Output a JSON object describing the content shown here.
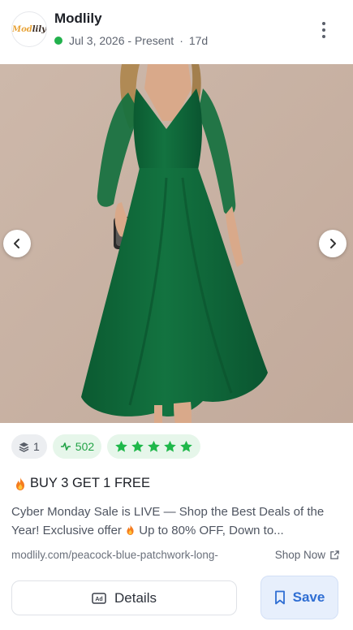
{
  "header": {
    "brand_name": "Modlily",
    "logo_text_a": "Mod",
    "logo_text_b": "lily",
    "date_range": "Jul 3, 2026 - Present",
    "separator": "·",
    "age": "17d",
    "status_color": "#22b14c"
  },
  "media": {
    "prev_icon": "chevron-left-icon",
    "next_icon": "chevron-right-icon",
    "background_color": "#c9b3a5",
    "dress_color": "#0f6638"
  },
  "stats": {
    "layers_count": "1",
    "activity_count": "502",
    "rating": 5,
    "rating_max": 5,
    "star_color": "#1fb84a"
  },
  "ad": {
    "headline": "BUY 3 GET 1 FREE",
    "description_part1": "Cyber Monday Sale is LIVE — Shop the Best Deals of the Year! Exclusive offer",
    "description_part2": "Up to 80% OFF, Down to...",
    "url": "modlily.com/peacock-blue-patchwork-long-",
    "shop_label": "Shop Now"
  },
  "actions": {
    "details_label": "Details",
    "save_label": "Save",
    "accent_color": "#2f6ed3"
  }
}
